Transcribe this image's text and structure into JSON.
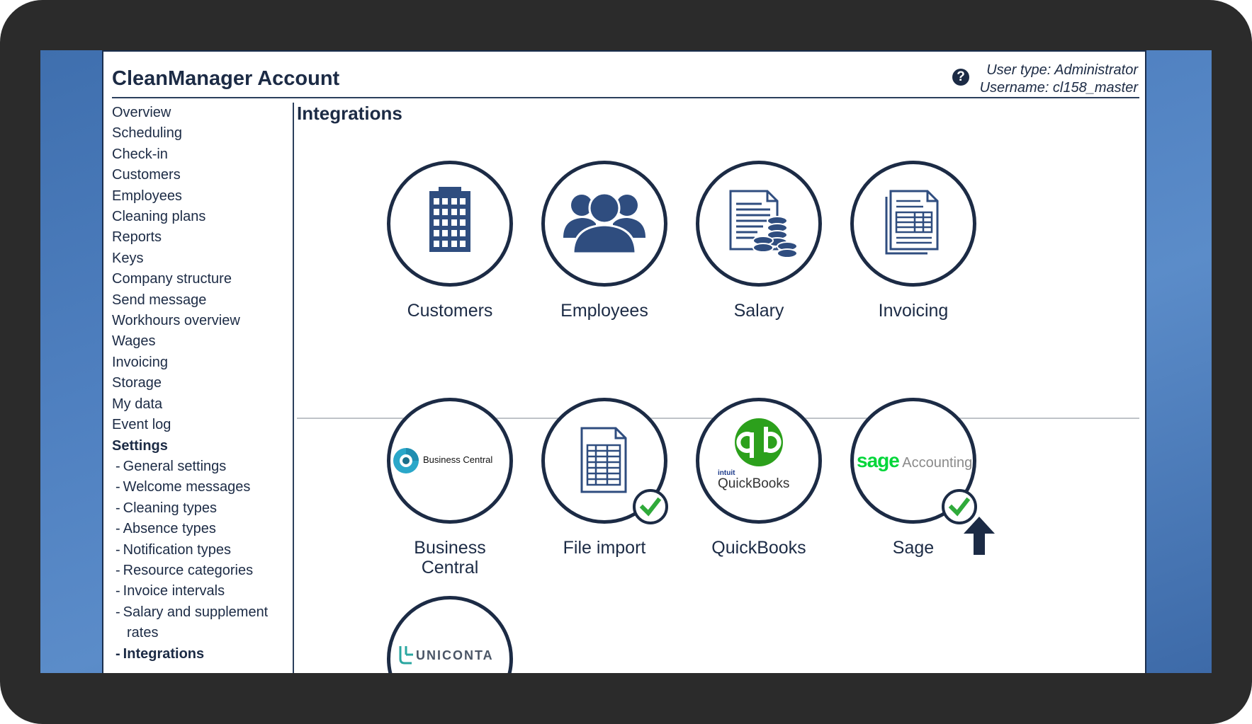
{
  "header": {
    "title": "CleanManager Account",
    "user_type": "User type: Administrator",
    "username": "Username: cl158_master"
  },
  "sidebar": {
    "items": [
      {
        "label": "Overview"
      },
      {
        "label": "Scheduling"
      },
      {
        "label": "Check-in"
      },
      {
        "label": "Customers"
      },
      {
        "label": "Employees"
      },
      {
        "label": "Cleaning plans"
      },
      {
        "label": "Reports"
      },
      {
        "label": "Keys"
      },
      {
        "label": "Company structure"
      },
      {
        "label": "Send message"
      },
      {
        "label": "Workhours overview"
      },
      {
        "label": "Wages"
      },
      {
        "label": "Invoicing"
      },
      {
        "label": "Storage"
      },
      {
        "label": "My data"
      },
      {
        "label": "Event log"
      }
    ],
    "settings_label": "Settings",
    "settings_items": [
      {
        "label": "General settings"
      },
      {
        "label": "Welcome messages"
      },
      {
        "label": "Cleaning types"
      },
      {
        "label": "Absence types"
      },
      {
        "label": "Notification types"
      },
      {
        "label": "Resource categories"
      },
      {
        "label": "Invoice intervals"
      },
      {
        "label": "Salary and supplement"
      },
      {
        "label": "Integrations"
      }
    ],
    "settings_item_wrap": "rates",
    "dash": "-"
  },
  "main": {
    "title": "Integrations",
    "data_tiles": [
      {
        "label": "Customers",
        "icon": "building-icon"
      },
      {
        "label": "Employees",
        "icon": "people-icon"
      },
      {
        "label": "Salary",
        "icon": "salary-document-icon"
      },
      {
        "label": "Invoicing",
        "icon": "invoice-document-icon"
      }
    ],
    "integration_tiles": [
      {
        "label_line1": "Business",
        "label_line2": "Central",
        "logo_text": "Business Central",
        "active": false
      },
      {
        "label": "File import",
        "active": true
      },
      {
        "label": "QuickBooks",
        "logo_small": "intuit",
        "logo_text": "QuickBooks",
        "active": false
      },
      {
        "label": "Sage",
        "logo_brand": "sage",
        "logo_text": "Accounting",
        "active": true
      },
      {
        "label": "",
        "logo_text": "UNICONTA",
        "active": false
      }
    ]
  },
  "colors": {
    "navy": "#1c2b45",
    "icon_blue": "#2f4d7f",
    "check_green": "#2faa3a",
    "qb_green": "#2ca01c",
    "sage_green": "#00d639",
    "uniconta_teal": "#2aa7a1",
    "background_blue": "#4f80c0"
  }
}
